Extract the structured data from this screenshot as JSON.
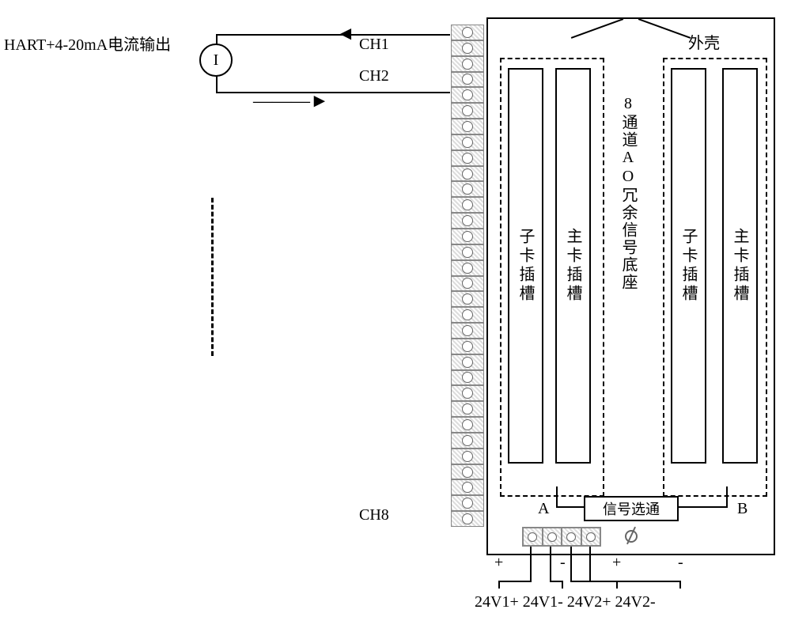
{
  "top_label": "HART+4-20mA电流输出",
  "current_symbol": "I",
  "channels": {
    "ch1": "CH1",
    "ch2": "CH2",
    "ch8": "CH8"
  },
  "enclosure": {
    "shell_label": "外壳",
    "center_label": "8通道AO冗余信号底座",
    "group_a": "A",
    "group_b": "B",
    "sub_slot": "子卡插槽",
    "main_slot": "主卡插槽",
    "signal_selector": "信号选通"
  },
  "polarity": {
    "plus": "+",
    "minus": "-"
  },
  "power_labels": "24V1+ 24V1- 24V2+ 24V2-",
  "arrows": {
    "left": "◄———",
    "right": "———►"
  }
}
